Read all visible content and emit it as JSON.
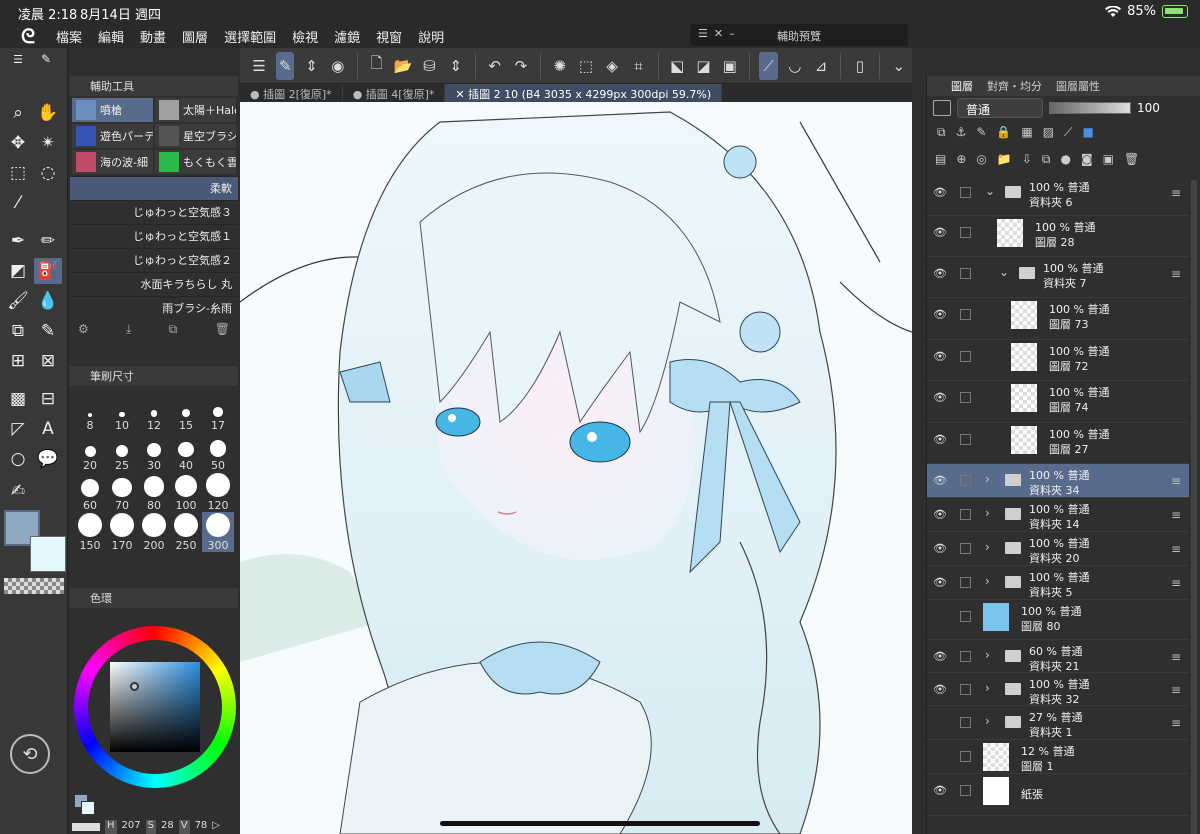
{
  "status": {
    "time": "凌晨 2:18",
    "date": "8月14日 週四",
    "battery": "85%"
  },
  "menu": [
    "檔案",
    "編輯",
    "動畫",
    "圖層",
    "選擇範圍",
    "檢視",
    "濾鏡",
    "視窗",
    "說明"
  ],
  "preview_window": {
    "title": "輔助預覽"
  },
  "tabs": [
    {
      "label": "插圖 2[復原]*"
    },
    {
      "label": "插圖 4[復原]*"
    },
    {
      "label": "插圖 2 10 (B4 3035 x 4299px 300dpi 59.7%)"
    }
  ],
  "subtool_panel": {
    "title": "輔助工具",
    "cells": [
      {
        "label": "噴槍",
        "color": "#6c8fc0"
      },
      {
        "label": "太陽＋Halo",
        "color": "#a0a0a0"
      },
      {
        "label": "遊色パーテ",
        "color": "#3455b5"
      },
      {
        "label": "星空ブラシ",
        "color": "#555555"
      },
      {
        "label": "海の波-細",
        "color": "#c24b6a"
      },
      {
        "label": "もくもく雲",
        "color": "#2db84a"
      }
    ],
    "brushes": [
      "柔軟",
      "じゅわっと空気感３",
      "じゅわっと空気感１",
      "じゅわっと空気感２",
      "水面キラちらし 丸",
      "雨ブラシ-糸雨"
    ]
  },
  "brush_size_panel": {
    "title": "筆刷尺寸",
    "sizes": [
      "8",
      "10",
      "12",
      "15",
      "17",
      "20",
      "25",
      "30",
      "40",
      "50",
      "60",
      "70",
      "80",
      "100",
      "120",
      "150",
      "170",
      "200",
      "250",
      "300"
    ],
    "selected": "300"
  },
  "color_panel": {
    "title": "色環",
    "main_color": "#8fa8c4",
    "sub_color": "#e6f8ff",
    "readout": {
      "h_label": "H",
      "h": "207",
      "s_label": "S",
      "s": "28",
      "v_label": "V",
      "v": "78"
    }
  },
  "layer_panel": {
    "tabs": [
      "圖層",
      "對齊・均分",
      "圖層屬性"
    ],
    "blend_mode": "普通",
    "opacity": "100",
    "layers": [
      {
        "mode": "100 % 普通",
        "name": "資料夾 6",
        "type": "folder",
        "expanded": true,
        "indent": 0,
        "visible": true
      },
      {
        "mode": "100 % 普通",
        "name": "圖層 28",
        "type": "layer",
        "indent": 1,
        "visible": true
      },
      {
        "mode": "100 % 普通",
        "name": "資料夾 7",
        "type": "folder",
        "expanded": true,
        "indent": 1,
        "visible": true
      },
      {
        "mode": "100 % 普通",
        "name": "圖層 73",
        "type": "layer",
        "indent": 2,
        "visible": true
      },
      {
        "mode": "100 % 普通",
        "name": "圖層 72",
        "type": "layer",
        "indent": 2,
        "visible": true
      },
      {
        "mode": "100 % 普通",
        "name": "圖層 74",
        "type": "layer",
        "indent": 2,
        "visible": true
      },
      {
        "mode": "100 % 普通",
        "name": "圖層 27",
        "type": "layer",
        "indent": 2,
        "visible": true
      },
      {
        "mode": "100 % 普通",
        "name": "資料夾 34",
        "type": "folder",
        "indent": 0,
        "visible": true,
        "selected": true
      },
      {
        "mode": "100 % 普通",
        "name": "資料夾 14",
        "type": "folder",
        "indent": 0,
        "visible": true
      },
      {
        "mode": "100 % 普通",
        "name": "資料夾 20",
        "type": "folder",
        "indent": 0,
        "visible": true
      },
      {
        "mode": "100 % 普通",
        "name": "資料夾 5",
        "type": "folder",
        "indent": 0,
        "visible": true
      },
      {
        "mode": "100 % 普通",
        "name": "圖層 80",
        "type": "layer",
        "indent": 0,
        "visible": false
      },
      {
        "mode": "60 % 普通",
        "name": "資料夾 21",
        "type": "folder",
        "indent": 0,
        "visible": true
      },
      {
        "mode": "100 % 普通",
        "name": "資料夾 32",
        "type": "folder",
        "indent": 0,
        "visible": true
      },
      {
        "mode": "27 % 普通",
        "name": "資料夾 1",
        "type": "folder",
        "indent": 0,
        "visible": false
      },
      {
        "mode": "12 % 普通",
        "name": "圖層 1",
        "type": "layer",
        "indent": 0,
        "visible": false
      },
      {
        "mode": "",
        "name": "紙張",
        "type": "paper",
        "indent": 0,
        "visible": true
      }
    ]
  }
}
